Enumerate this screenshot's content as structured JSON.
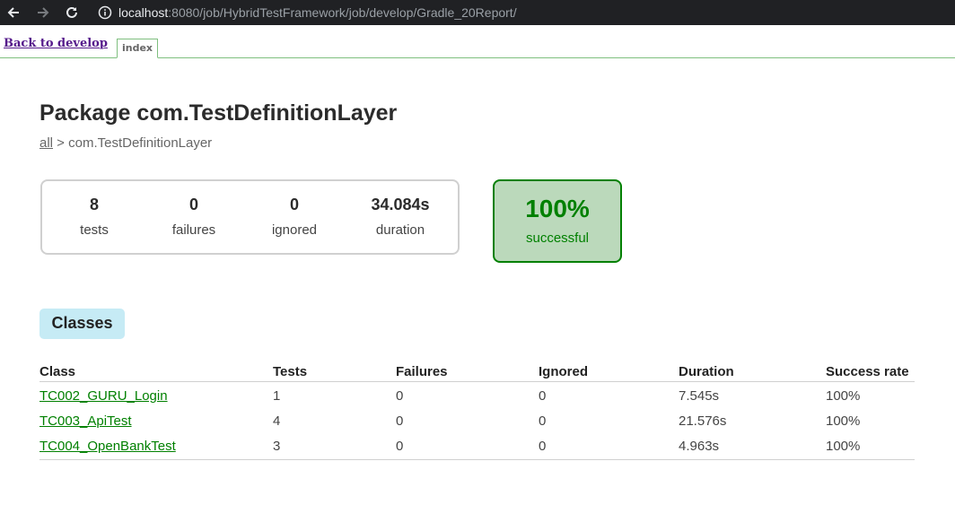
{
  "browser": {
    "url_host": "localhost",
    "url_path": ":8080/job/HybridTestFramework/job/develop/Gradle_20Report/"
  },
  "frame": {
    "back_link": "Back to develop",
    "tab_label": "index"
  },
  "page": {
    "title": "Package com.TestDefinitionLayer",
    "breadcrumb_root": "all",
    "breadcrumb_rest": " > com.TestDefinitionLayer"
  },
  "summary": {
    "tests": {
      "value": "8",
      "label": "tests"
    },
    "failures": {
      "value": "0",
      "label": "failures"
    },
    "ignored": {
      "value": "0",
      "label": "ignored"
    },
    "duration": {
      "value": "34.084s",
      "label": "duration"
    },
    "success": {
      "value": "100%",
      "label": "successful"
    }
  },
  "classes_tab": "Classes",
  "table": {
    "headers": [
      "Class",
      "Tests",
      "Failures",
      "Ignored",
      "Duration",
      "Success rate"
    ],
    "rows": [
      [
        "TC002_GURU_Login",
        "1",
        "0",
        "0",
        "7.545s",
        "100%"
      ],
      [
        "TC003_ApiTest",
        "4",
        "0",
        "0",
        "21.576s",
        "100%"
      ],
      [
        "TC004_OpenBankTest",
        "3",
        "0",
        "0",
        "4.963s",
        "100%"
      ]
    ]
  },
  "colors": {
    "success_green": "#008000",
    "success_bg": "#bbd9bb",
    "tab_bg": "#c6ebf5",
    "chrome_bg": "#202124"
  }
}
